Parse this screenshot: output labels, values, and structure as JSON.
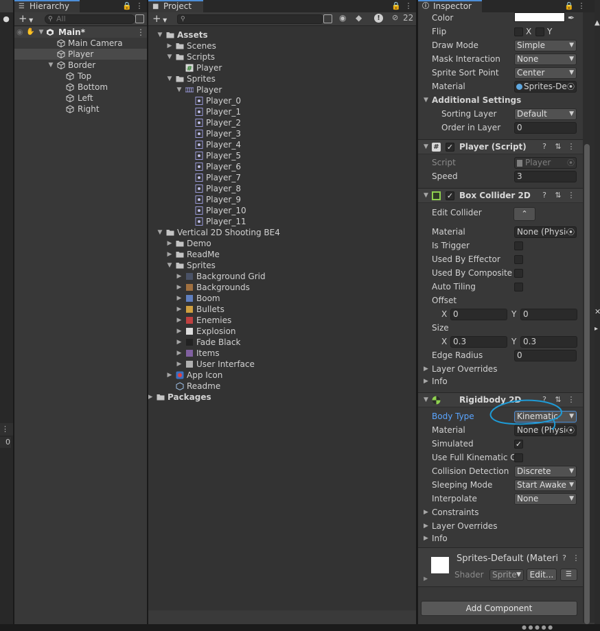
{
  "hierarchy": {
    "tab_label": "Hierarchy",
    "search_placeholder": "All",
    "add_label": "+",
    "scene_name": "Main*",
    "objects": [
      {
        "name": "Main Camera"
      },
      {
        "name": "Player"
      },
      {
        "name": "Border"
      },
      {
        "name": "Top"
      },
      {
        "name": "Bottom"
      },
      {
        "name": "Left"
      },
      {
        "name": "Right"
      }
    ]
  },
  "left_strip": {
    "badge": "0"
  },
  "project": {
    "tab_label": "Project",
    "add_label": "+",
    "hidden_count": "22",
    "tree": {
      "assets": "Assets",
      "scenes": "Scenes",
      "scripts": "Scripts",
      "player_script": "Player",
      "sprites": "Sprites",
      "player_sheet": "Player",
      "player_frames": [
        "Player_0",
        "Player_1",
        "Player_2",
        "Player_3",
        "Player_4",
        "Player_5",
        "Player_6",
        "Player_7",
        "Player_8",
        "Player_9",
        "Player_10",
        "Player_11"
      ],
      "pack": "Vertical 2D Shooting BE4",
      "demo": "Demo",
      "readme_folder": "ReadMe",
      "pack_sprites": "Sprites",
      "pack_items": [
        "Background Grid",
        "Backgrounds",
        "Boom",
        "Bullets",
        "Enemies",
        "Explosion",
        "Fade Black",
        "Items",
        "User Interface"
      ],
      "app_icon": "App Icon",
      "readme": "Readme",
      "packages": "Packages"
    }
  },
  "inspector": {
    "tab_label": "Inspector",
    "sprite_renderer": {
      "color_label": "Color",
      "flip_label": "Flip",
      "flip_x": "X",
      "flip_y": "Y",
      "draw_mode_label": "Draw Mode",
      "draw_mode": "Simple",
      "mask_label": "Mask Interaction",
      "mask": "None",
      "sort_point_label": "Sprite Sort Point",
      "sort_point": "Center",
      "material_label": "Material",
      "material": "Sprites-De",
      "additional_label": "Additional Settings",
      "sorting_layer_label": "Sorting Layer",
      "sorting_layer": "Default",
      "order_label": "Order in Layer",
      "order": "0"
    },
    "player_script": {
      "title": "Player (Script)",
      "script_label": "Script",
      "script": "Player",
      "speed_label": "Speed",
      "speed": "3"
    },
    "box_collider": {
      "title": "Box Collider 2D",
      "edit_label": "Edit Collider",
      "material_label": "Material",
      "material": "None (Physic",
      "is_trigger_label": "Is Trigger",
      "effector_label": "Used By Effector",
      "composite_label": "Used By Composite",
      "tiling_label": "Auto Tiling",
      "offset_label": "Offset",
      "offset_x": "0",
      "offset_y": "0",
      "size_label": "Size",
      "size_x": "0.3",
      "size_y": "0.3",
      "x_label": "X",
      "y_label": "Y",
      "edge_label": "Edge Radius",
      "edge": "0",
      "layer_overrides": "Layer Overrides",
      "info": "Info"
    },
    "rigidbody": {
      "title": "Rigidbody 2D",
      "body_type_label": "Body Type",
      "body_type": "Kinematic",
      "material_label": "Material",
      "material": "None (Physic",
      "simulated_label": "Simulated",
      "full_kin_label": "Use Full Kinematic Co",
      "collision_label": "Collision Detection",
      "collision": "Discrete",
      "sleeping_label": "Sleeping Mode",
      "sleeping": "Start Awake",
      "interpolate_label": "Interpolate",
      "interpolate": "None",
      "constraints": "Constraints",
      "layer_overrides": "Layer Overrides",
      "info": "Info"
    },
    "material_preview": {
      "name": "Sprites-Default (Materi",
      "shader_label": "Shader",
      "shader": "Sprite",
      "edit_label": "Edit..."
    },
    "add_component": "Add Component"
  },
  "colors": {
    "accent": "#4d8fd8",
    "annotation": "#1e9bd6",
    "panel": "#383838",
    "field": "#2a2a2a"
  }
}
